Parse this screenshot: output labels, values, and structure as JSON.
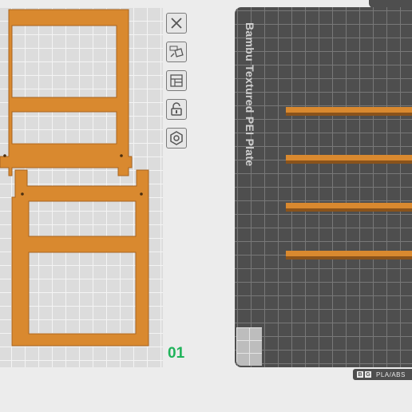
{
  "build_plate": {
    "name": "Bambu Textured PEI Plate",
    "material_badge": "PLA/ABS",
    "plate_number": "01"
  },
  "toolbar": {
    "items": [
      {
        "name": "close",
        "icon": "close-icon"
      },
      {
        "name": "auto-orient",
        "icon": "auto-orient-icon"
      },
      {
        "name": "arrange",
        "icon": "arrange-icon"
      },
      {
        "name": "lock",
        "icon": "lock-icon"
      },
      {
        "name": "settings",
        "icon": "gear-icon"
      }
    ]
  },
  "colors": {
    "filament": "#d9892f",
    "plate_dark": "#4e4e4e",
    "plate_light": "#dcdcdc",
    "plate_number": "#1fb35a"
  }
}
